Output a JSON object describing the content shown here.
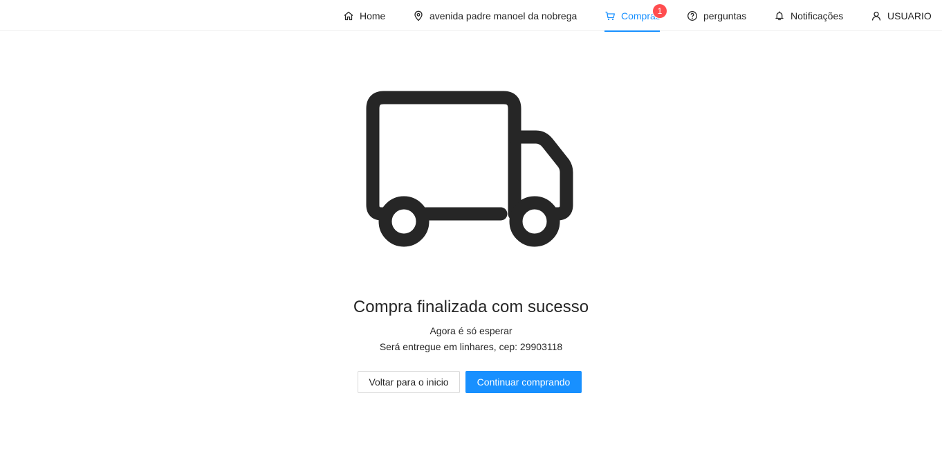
{
  "nav": {
    "home": "Home",
    "address": "avenida padre manoel da nobrega",
    "cart": "Compras",
    "cart_badge": "1",
    "questions": "perguntas",
    "notifications": "Notificações",
    "user": "USUARIO"
  },
  "result": {
    "icon": "truck-icon",
    "title": "Compra finalizada com sucesso",
    "subtitle": "Agora é só esperar",
    "delivery": "Será entregue em linhares, cep: 29903118"
  },
  "actions": {
    "back_label": "Voltar para o inicio",
    "continue_label": "Continuar comprando"
  },
  "colors": {
    "accent": "#1890ff",
    "badge": "#ff4d4f",
    "icon": "#262626"
  }
}
